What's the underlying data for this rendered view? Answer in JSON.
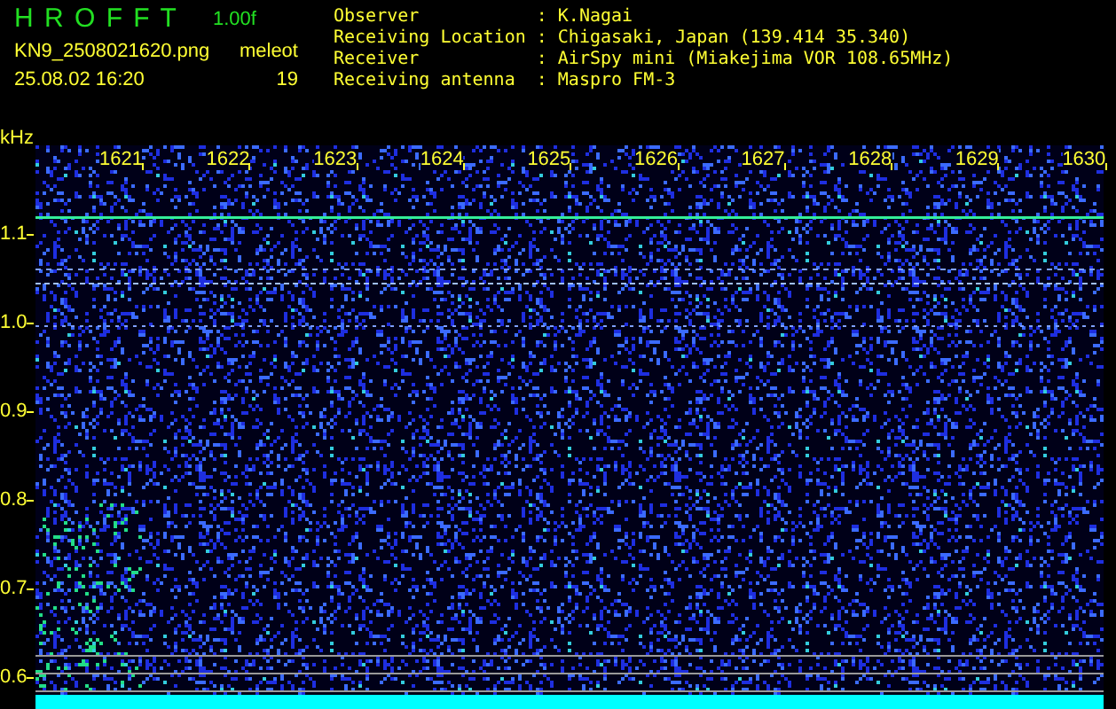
{
  "app": {
    "title": "H R O F F T",
    "version": "1.00f",
    "filename": "KN9_2508021620.png",
    "datetime": "25.08.02 16:20",
    "mode": "meleot",
    "count": "19"
  },
  "info": [
    {
      "label": "Observer",
      "separator": ":",
      "value": "K.Nagai"
    },
    {
      "label": "Receiving Location",
      "separator": ":",
      "value": "Chigasaki, Japan (139.414 35.340)"
    },
    {
      "label": "Receiver",
      "separator": ":",
      "value": "AirSpy mini (Miakejima VOR 108.65MHz)"
    },
    {
      "label": "Receiving antenna",
      "separator": ":",
      "value": "Maspro FM-3"
    }
  ],
  "axis": {
    "unit": "kHz",
    "x_ticks": [
      "1621",
      "1622",
      "1623",
      "1624",
      "1625",
      "1626",
      "1627",
      "1628",
      "1629",
      "1630"
    ],
    "y_ticks": [
      "1.1",
      "1.0",
      "0.9",
      "0.8",
      "0.7",
      "0.6"
    ]
  }
}
